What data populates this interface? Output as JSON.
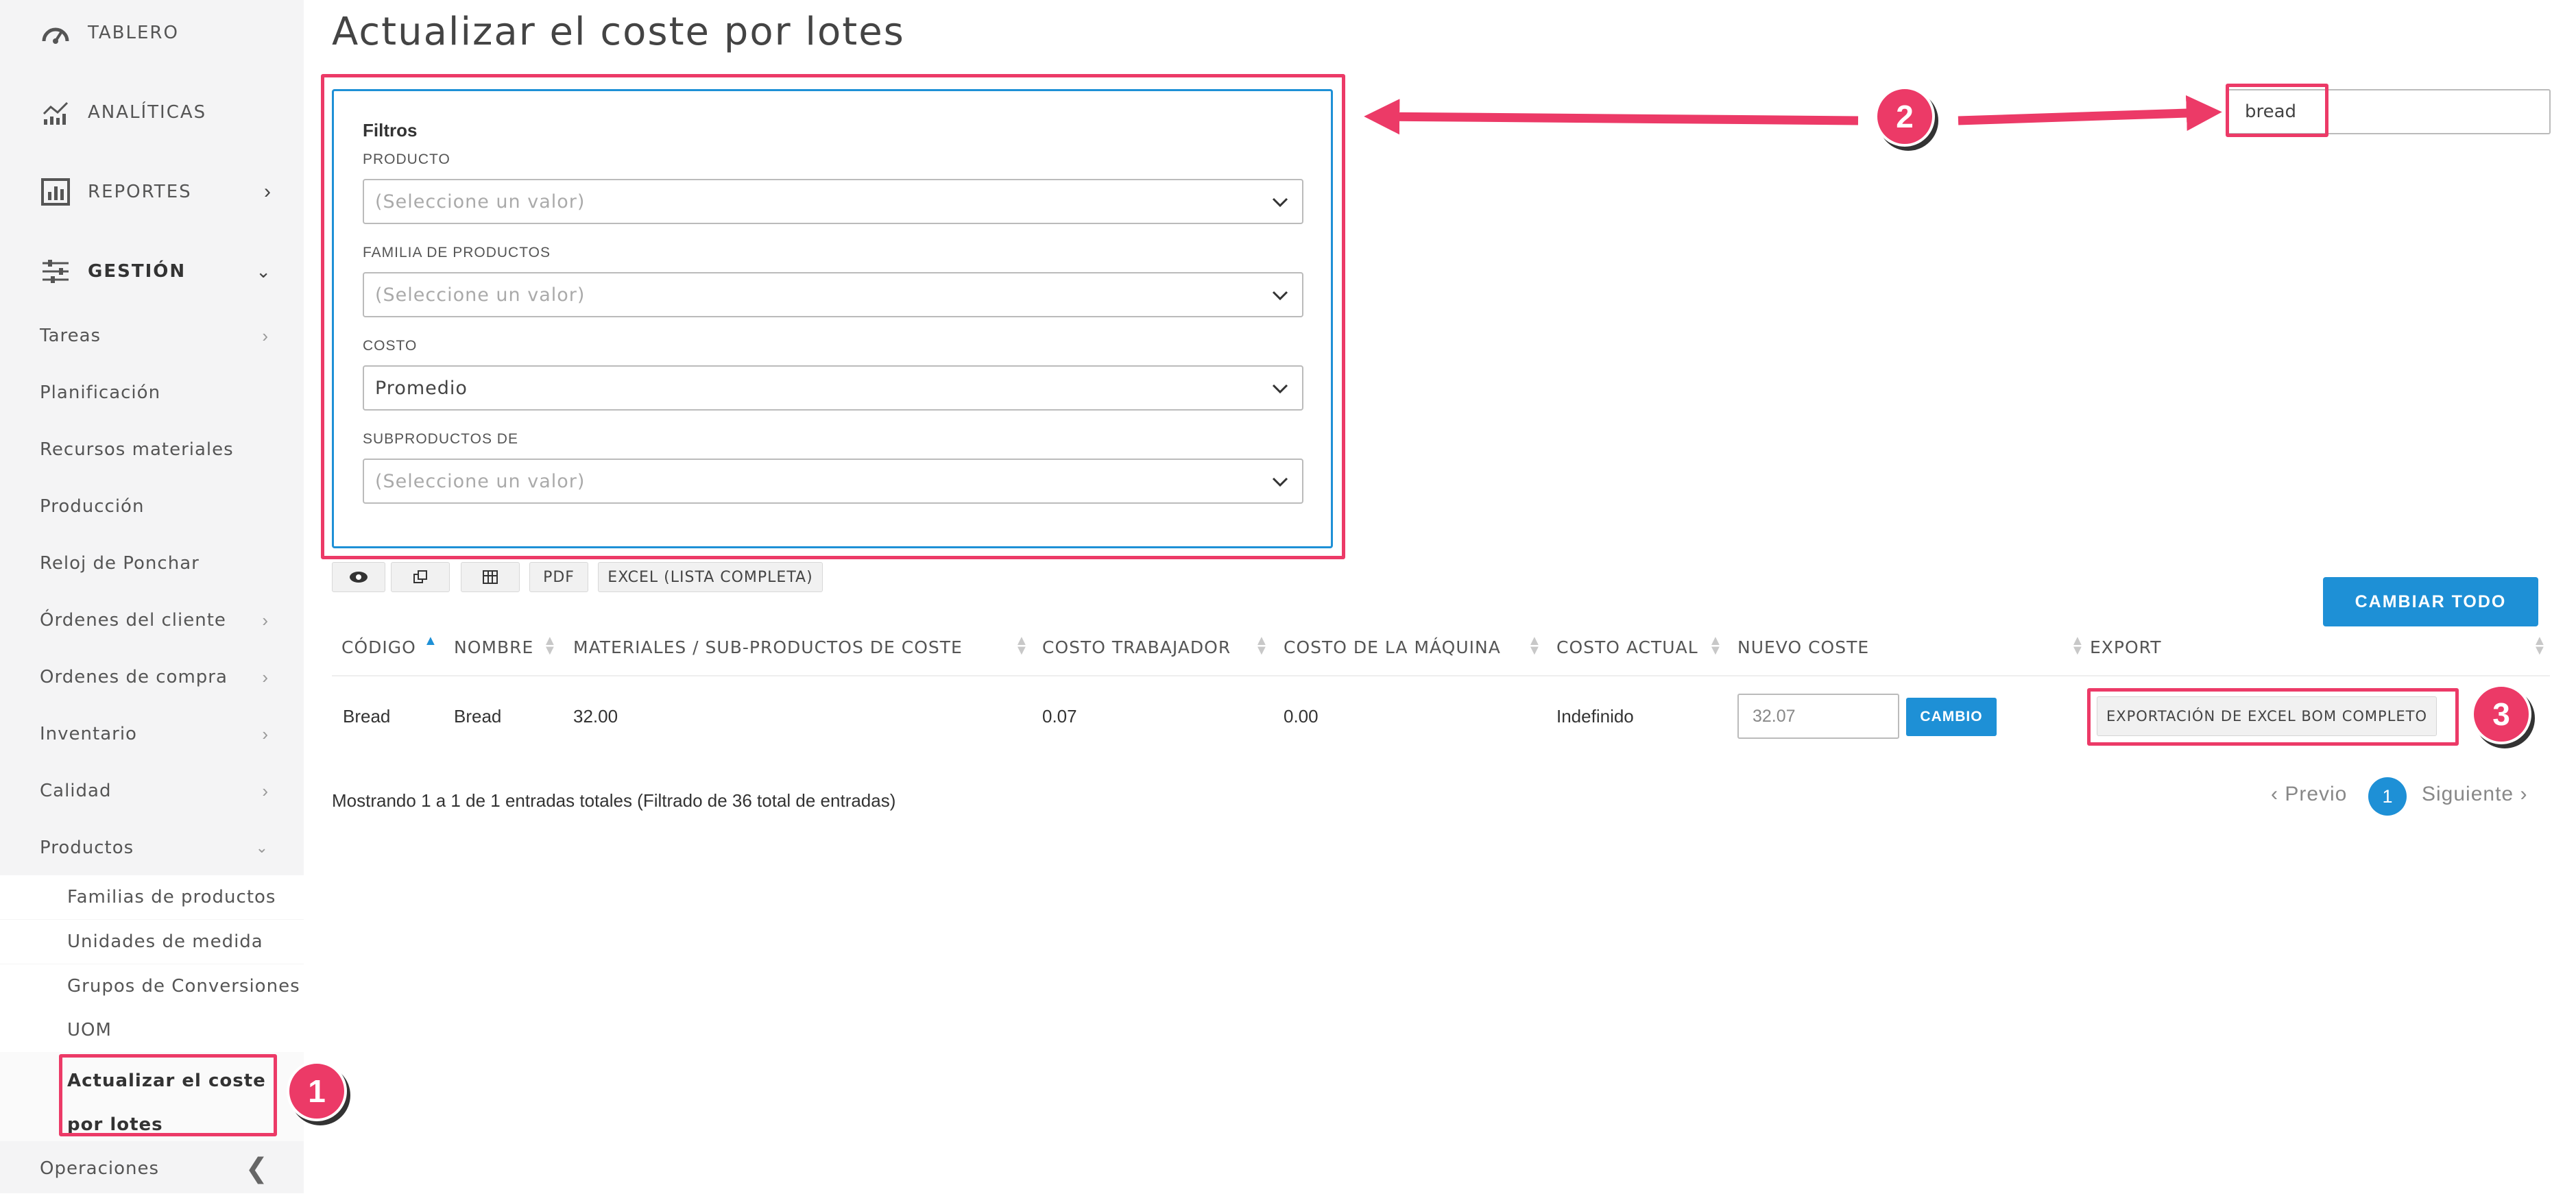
{
  "sidebar": {
    "main_items": [
      {
        "label": "TABLERO",
        "icon": "dashboard-gauge-icon"
      },
      {
        "label": "ANALÍTICAS",
        "icon": "analytics-chart-icon"
      },
      {
        "label": "REPORTES",
        "icon": "reports-bar-icon"
      },
      {
        "label": "GESTIÓN",
        "icon": "sliders-icon"
      }
    ],
    "sub_items": [
      "Tareas",
      "Planificación",
      "Recursos materiales",
      "Producción",
      "Reloj de Ponchar",
      "Órdenes del cliente",
      "Ordenes de compra",
      "Inventario",
      "Calidad",
      "Productos"
    ],
    "product_items": [
      "Familias de productos",
      "Unidades de medida",
      "Grupos de Conversiones",
      "UOM"
    ],
    "active_item": "Actualizar el coste por lotes",
    "footer_item": "Operaciones"
  },
  "page": {
    "title": "Actualizar el coste por lotes"
  },
  "filters": {
    "title": "Filtros",
    "fields": [
      {
        "label": "PRODUCTO",
        "value": "(Seleccione un valor)"
      },
      {
        "label": "FAMILIA DE PRODUCTOS",
        "value": "(Seleccione un valor)"
      },
      {
        "label": "COSTO",
        "value": "Promedio"
      },
      {
        "label": "SUBPRODUCTOS DE",
        "value": "(Seleccione un valor)"
      }
    ]
  },
  "search": {
    "value": "bread"
  },
  "toolbar": {
    "pdf": "PDF",
    "excel": "EXCEL (LISTA COMPLETA)",
    "change_all": "CAMBIAR TODO"
  },
  "table": {
    "columns": [
      "CÓDIGO",
      "NOMBRE",
      "MATERIALES / SUB-PRODUCTOS DE COSTE",
      "COSTO TRABAJADOR",
      "COSTO DE LA MÁQUINA",
      "COSTO ACTUAL",
      "NUEVO COSTE",
      "EXPORT"
    ],
    "rows": [
      {
        "code": "Bread",
        "name": "Bread",
        "materials": "32.00",
        "worker": "0.07",
        "machine": "0.00",
        "current": "Indefinido",
        "new_cost": "32.07",
        "change": "CAMBIO",
        "export": "EXPORTACIÓN DE EXCEL BOM COMPLETO"
      }
    ]
  },
  "pagination": {
    "info": "Mostrando 1 a 1 de 1 entradas totales (Filtrado de 36 total de entradas)",
    "prev": "Previo",
    "current": "1",
    "next": "Siguiente"
  },
  "annotations": [
    "1",
    "2",
    "3"
  ],
  "colors": {
    "accent": "#1e90d6",
    "highlight": "#ec3a67"
  }
}
